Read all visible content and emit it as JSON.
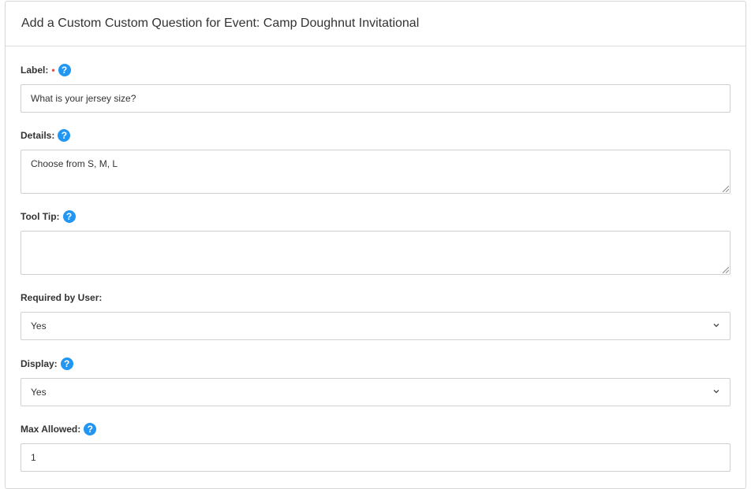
{
  "header": {
    "title": "Add a Custom Custom Question for Event: Camp Doughnut Invitational"
  },
  "form": {
    "label": {
      "label": "Label:",
      "required_mark": "•",
      "value": "What is your jersey size?"
    },
    "details": {
      "label": "Details:",
      "value": "Choose from S, M, L"
    },
    "tooltip": {
      "label": "Tool Tip:",
      "value": ""
    },
    "required_by_user": {
      "label": "Required by User:",
      "value": "Yes"
    },
    "display": {
      "label": "Display:",
      "value": "Yes"
    },
    "max_allowed": {
      "label": "Max Allowed:",
      "value": "1"
    }
  },
  "icons": {
    "help": "?"
  },
  "colors": {
    "help_icon": "#2196f3",
    "required": "#d9534f"
  }
}
